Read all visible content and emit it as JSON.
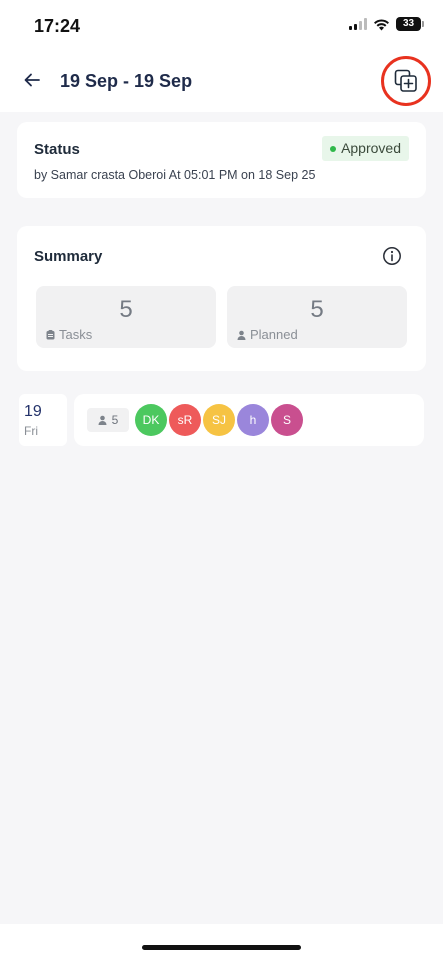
{
  "status_bar": {
    "time": "17:24",
    "battery": "33"
  },
  "header": {
    "title": "19 Sep - 19 Sep"
  },
  "status_card": {
    "title": "Status",
    "badge": "Approved",
    "subtitle": "by Samar crasta Oberoi At 05:01 PM on 18 Sep 25"
  },
  "summary": {
    "title": "Summary",
    "tasks": {
      "value": "5",
      "label": "Tasks"
    },
    "planned": {
      "value": "5",
      "label": "Planned"
    }
  },
  "day": {
    "number": "19",
    "name": "Fri",
    "count": "5",
    "avatars": [
      {
        "initials": "DK",
        "color": "#4cc85f"
      },
      {
        "initials": "sR",
        "color": "#ee5a5a"
      },
      {
        "initials": "SJ",
        "color": "#f6c343"
      },
      {
        "initials": "h",
        "color": "#9a86db"
      },
      {
        "initials": "S",
        "color": "#c94f8f"
      }
    ]
  },
  "colors": {
    "accent": "#23326a",
    "approved_dot": "#2fb84a",
    "highlight": "#e8321f"
  }
}
